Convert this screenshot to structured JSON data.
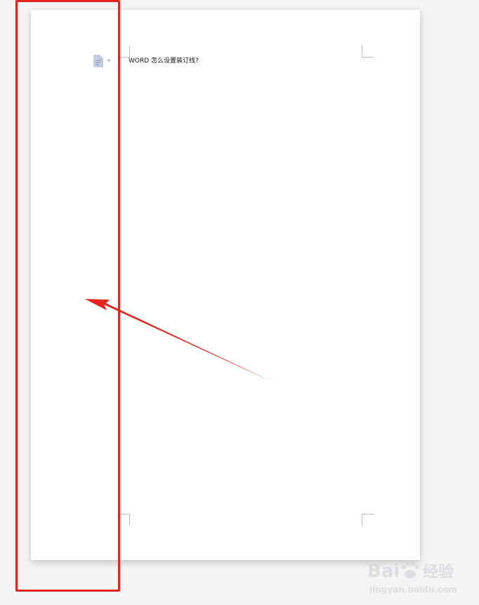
{
  "document": {
    "title": "WORD 怎么设置装订线?"
  },
  "icons": {
    "paragraph_icon": "document-icon",
    "dropdown": "chevron-down-icon"
  },
  "annotation": {
    "color": "#e8231d"
  },
  "watermark": {
    "brand": "Bai",
    "brand_suffix": "经验",
    "url": "jingyan.baidu.com"
  }
}
